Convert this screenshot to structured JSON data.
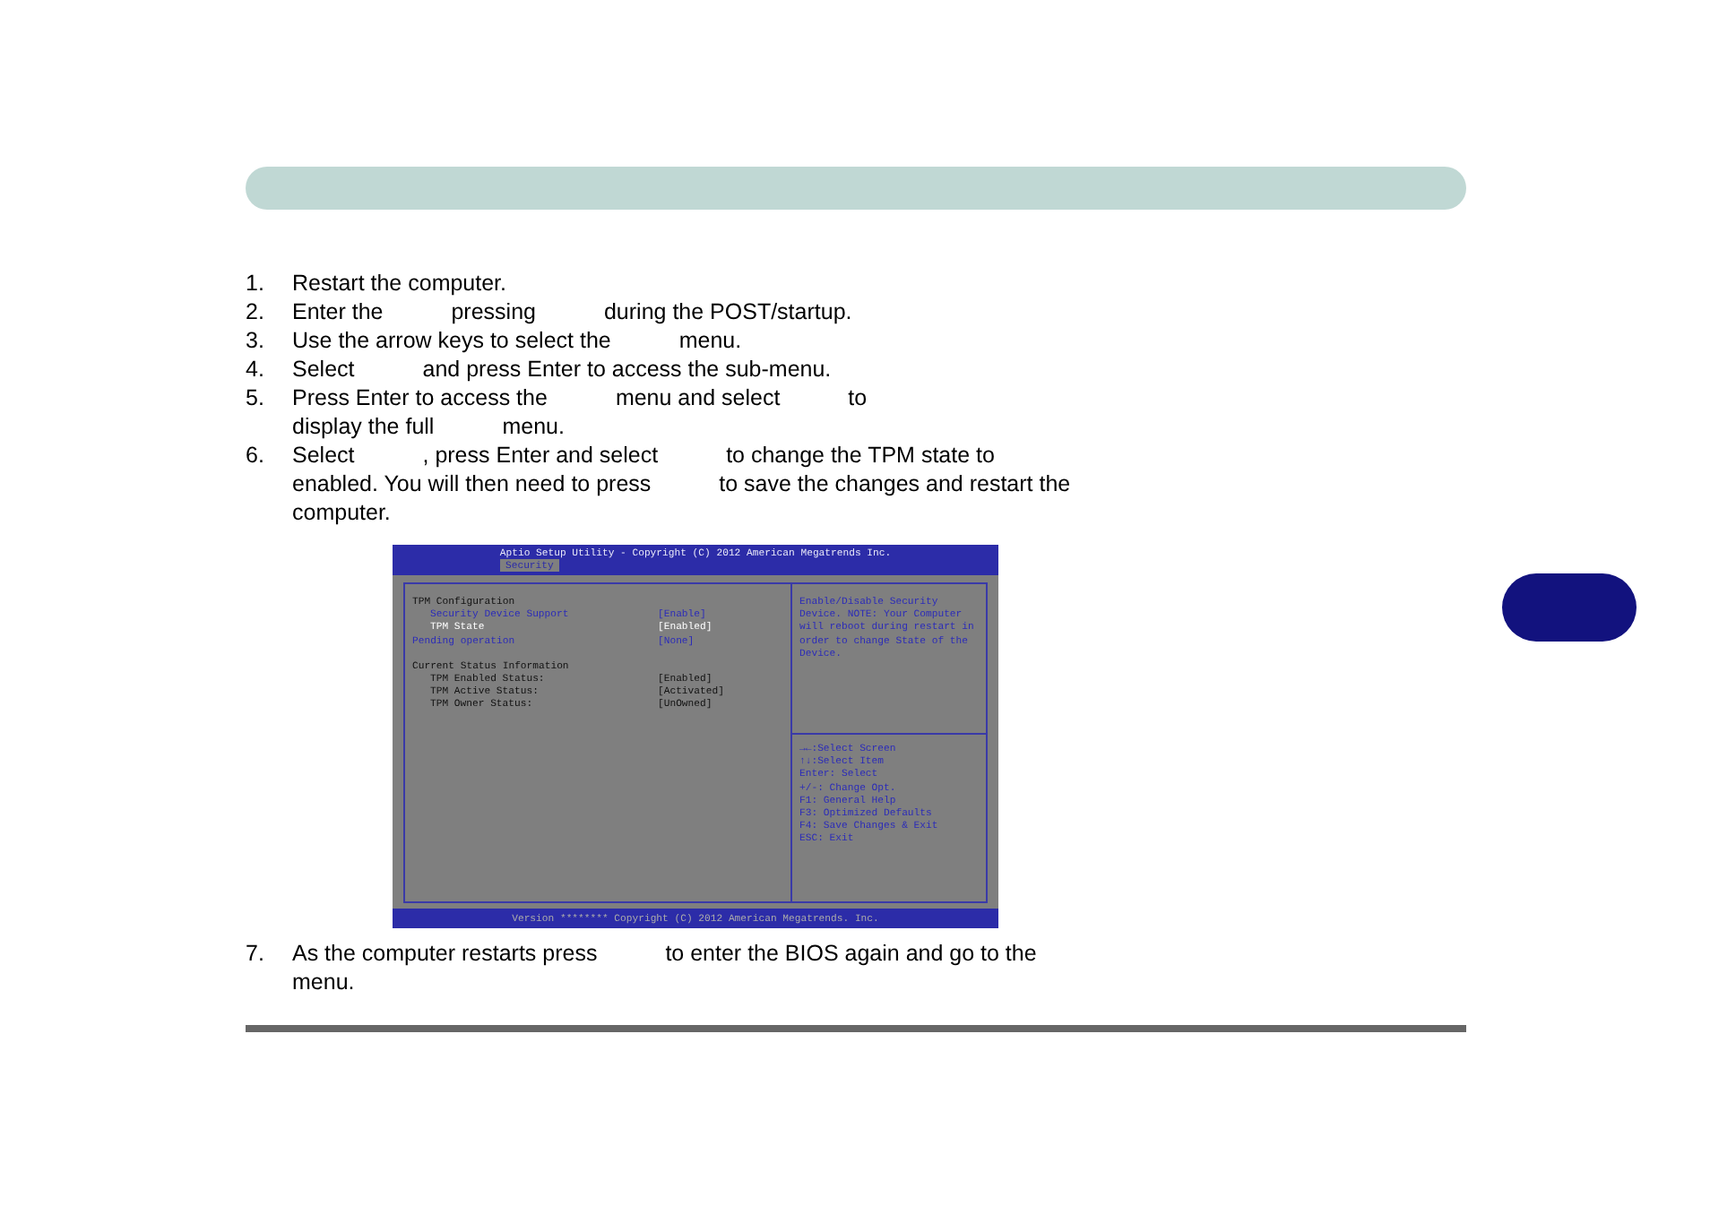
{
  "steps": [
    {
      "number": "1.",
      "lines": [
        [
          "Restart the computer."
        ]
      ]
    },
    {
      "number": "2.",
      "lines": [
        [
          "Enter the",
          "pressing",
          "during the POST/startup."
        ]
      ]
    },
    {
      "number": "3.",
      "lines": [
        [
          "Use the arrow keys to select the",
          "menu."
        ]
      ]
    },
    {
      "number": "4.",
      "lines": [
        [
          "Select",
          "and press Enter to access the sub-menu."
        ]
      ]
    },
    {
      "number": "5.",
      "lines": [
        [
          "Press Enter to access the",
          "menu and select",
          "to"
        ],
        [
          "display the full",
          "menu."
        ]
      ]
    },
    {
      "number": "6.",
      "lines": [
        [
          "Select",
          ", press Enter and select",
          "to change the TPM state to"
        ],
        [
          "enabled. You will then need to press",
          "to save the changes and restart the"
        ],
        [
          "computer."
        ]
      ]
    }
  ],
  "bios": {
    "title": "Aptio Setup Utility - Copyright (C) 2012 American Megatrends Inc.",
    "tabs": [
      {
        "label": "Security",
        "selected": true
      }
    ],
    "rows": [
      {
        "kind": "heading",
        "label": "TPM Configuration",
        "children": [
          {
            "kind": "option",
            "label": "Security Device Support",
            "value": "[Enable]",
            "selected": false
          },
          {
            "kind": "option",
            "label": "TPM State",
            "value": "[Enabled]",
            "selected": true
          }
        ]
      },
      {
        "kind": "option",
        "label": "Pending operation",
        "value": "[None]",
        "selected": false
      },
      {
        "kind": "heading",
        "label": "Current Status Information",
        "children": [
          {
            "kind": "info",
            "label": "TPM Enabled Status:",
            "value": "[Enabled]"
          },
          {
            "kind": "info",
            "label": "TPM Active Status:",
            "value": "[Activated]"
          },
          {
            "kind": "info",
            "label": "TPM Owner Status:",
            "value": "[UnOwned]"
          }
        ]
      }
    ],
    "help": "Enable/Disable Security Device. NOTE: Your Computer will reboot during restart in order to change State of the Device.",
    "keys": [
      "→←:Select Screen",
      "↑↓:Select Item",
      "Enter: Select",
      "+/-: Change Opt.",
      "F1: General Help",
      "F3: Optimized Defaults",
      "F4: Save Changes & Exit",
      "ESC: Exit"
    ],
    "footer": "Version ******** Copyright (C) 2012 American Megatrends. Inc."
  },
  "after_steps": [
    {
      "number": "7.",
      "lines": [
        [
          "As the computer restarts press",
          "to enter the BIOS again and go to the"
        ],
        [
          "menu."
        ]
      ]
    }
  ]
}
